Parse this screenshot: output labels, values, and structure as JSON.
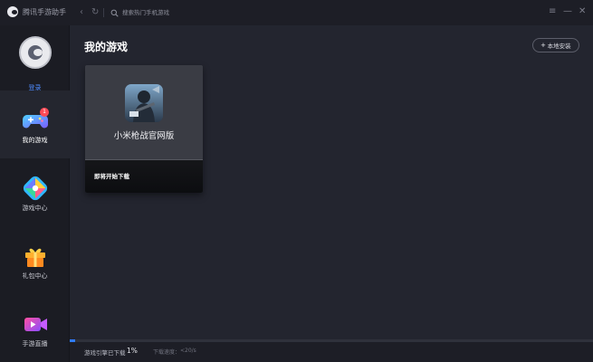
{
  "app": {
    "title": "腾讯手游助手"
  },
  "titlebar": {
    "back_label": "‹",
    "forward_label": "›",
    "refresh_label": "↻",
    "search": {
      "placeholder": "搜索热门手机游戏"
    },
    "menu_label": "≡",
    "minimize_label": "—",
    "close_label": "✕"
  },
  "sidebar": {
    "login_label": "登录",
    "items": [
      {
        "label": "我的游戏",
        "icon": "gamepad-icon",
        "badge": "1",
        "active": true
      },
      {
        "label": "游戏中心",
        "icon": "game-center-icon",
        "active": false
      },
      {
        "label": "礼包中心",
        "icon": "gift-icon",
        "active": false
      },
      {
        "label": "手游直播",
        "icon": "live-video-icon",
        "active": false
      }
    ]
  },
  "main": {
    "title": "我的游戏",
    "local_install_label": "本地安装",
    "games": [
      {
        "name": "小米枪战官网版",
        "status": "即将开始下载"
      }
    ]
  },
  "statusbar": {
    "engine_label": "游戏引擎已下载",
    "engine_percent": "1%",
    "engine_progress": 0.01,
    "speed_label": "下载速度：",
    "speed_value": "<20/s"
  },
  "colors": {
    "accent": "#2f7bff",
    "login_link": "#4f8cff",
    "badge": "#ff4a56",
    "background": "#23252f",
    "sidebar": "#1b1c23"
  }
}
